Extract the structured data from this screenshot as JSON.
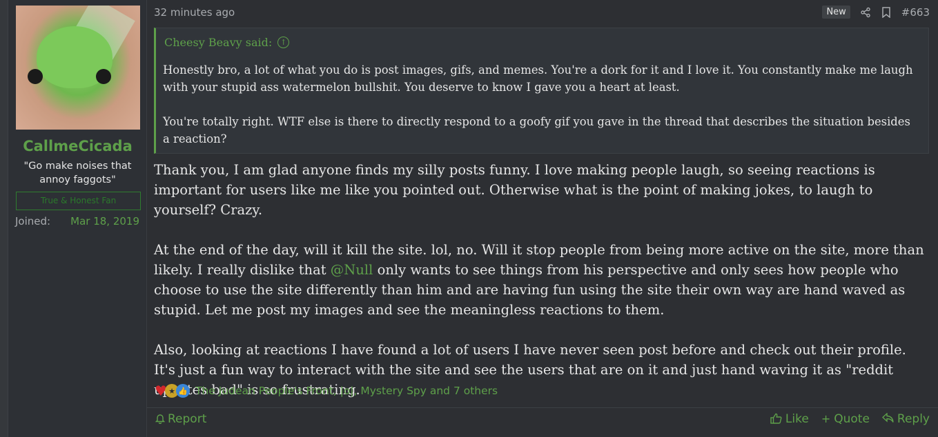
{
  "user": {
    "username": "CallmeCicada",
    "title": "\"Go make noises that annoy faggots\"",
    "banner": "True & Honest Fan",
    "joined_label": "Joined:",
    "joined_value": "Mar 18, 2019"
  },
  "post": {
    "timestamp": "32 minutes ago",
    "new_badge": "New",
    "post_number": "#663",
    "quote": {
      "author": "Cheesy Beavy said:",
      "paragraphs": [
        "Honestly bro, a lot of what you do is post images, gifs, and memes. You're a dork for it and I love it. You constantly make me laugh with your stupid ass watermelon bullshit. You deserve to know I gave you a heart at least.",
        "You're totally right. WTF else is there to directly respond to a goofy gif you gave in the thread that describes the situation besides a reaction?"
      ]
    },
    "body": {
      "p1": "Thank you, I am glad anyone finds my silly posts funny. I love making people laugh, so seeing reactions is important for users like me like you pointed out. Otherwise what is the point of making jokes, to laugh to yourself? Crazy.",
      "p2_before": "At the end of the day, will it kill the site. lol, no. Will it stop people from being more active on the site, more than likely. I really dislike that ",
      "p2_mention": "@Null",
      "p2_after": " only wants to see things from his perspective and only sees how people who choose to use the site differently than him and are having fun using the site their own way are hand waved as stupid. Let me post my images and see the meaningless reactions to them.",
      "p3": "Also, looking at reactions I have found a lot of users I have never seen post before and check out their profile. It's just a fun way to interact with the site and see the users that are on it and just hand waving it as \"reddit upvotes bad\" is so frustrating."
    },
    "reactions": {
      "icons": [
        "heart-icon",
        "medal-icon",
        "thumbs-up-icon"
      ],
      "text": "The Judean People's Front, |o|, Mystery Spy and 7 others"
    },
    "footer": {
      "report": "Report",
      "like": "Like",
      "quote": "Quote",
      "reply": "Reply"
    }
  },
  "colors": {
    "accent": "#5ea04a",
    "background": "#2d2f33",
    "text": "#e6e6e6",
    "muted": "#a9acb0"
  }
}
